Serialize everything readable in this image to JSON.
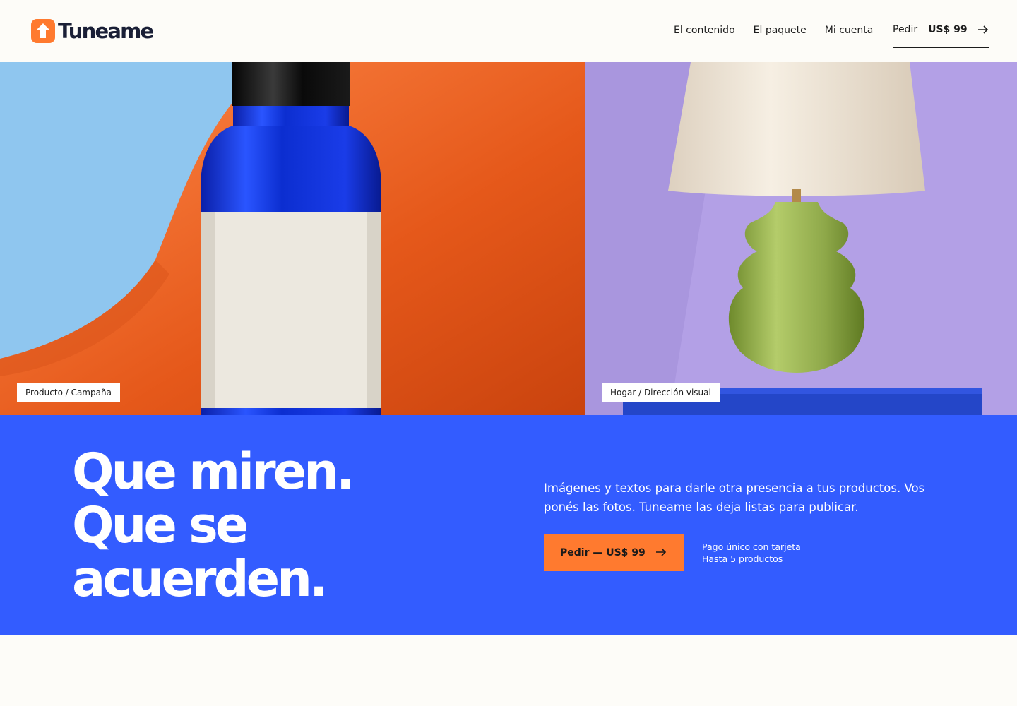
{
  "brand": {
    "name": "Tuneame",
    "logo_icon": "arrow-up-icon",
    "accent": "#ff7a2f",
    "band_color": "#335cff"
  },
  "nav": {
    "items": [
      {
        "label": "El contenido"
      },
      {
        "label": "El paquete"
      },
      {
        "label": "Mi cuenta"
      }
    ],
    "cta": {
      "label": "Pedir",
      "price": "US$ 99",
      "icon": "arrow-right-icon"
    }
  },
  "gallery": [
    {
      "tag": "Producto / Campaña"
    },
    {
      "tag": "Hogar / Dirección visual"
    }
  ],
  "hero": {
    "headline": [
      "Que miren.",
      "Que se",
      "acuerden."
    ],
    "description": "Imágenes y textos para darle otra presencia a tus productos. Vos ponés las fotos. Tuneame las deja listas para publicar.",
    "cta_label": "Pedir — US$ 99",
    "notes": [
      "Pago único con tarjeta",
      "Hasta 5 productos"
    ]
  }
}
